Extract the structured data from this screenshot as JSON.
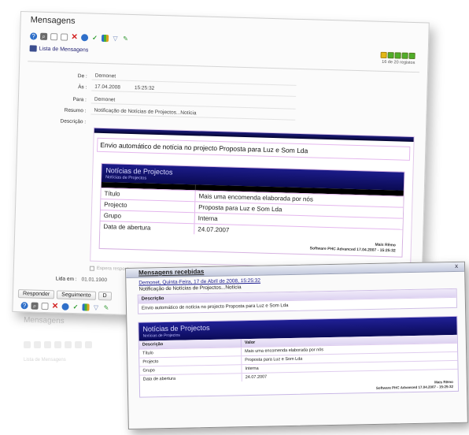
{
  "main_window": {
    "title": "Mensagens",
    "title_right": "",
    "list_link": "Lista de Mensagens",
    "record_count": "16 de 20 registos",
    "fields": [
      {
        "label": "De :",
        "value": "Demonet"
      },
      {
        "label": "Às :",
        "value": "17.04.2008          15:25:32"
      },
      {
        "label": "Para :",
        "value": "Demonet"
      },
      {
        "label": "Resumo :",
        "value": "Notificação de Notícias de Projectos...Notícia"
      },
      {
        "label": "Descrição :",
        "value": ""
      }
    ],
    "description_text": "Envio automático de notícia no projecto Proposta para Luz e Som Lda",
    "card": {
      "title": "Notícias de Projectos",
      "subtitle": "Notícias de Projectos",
      "rows": [
        {
          "key": "Título",
          "value": "Mais uma encomenda elaborada por nós"
        },
        {
          "key": "Projecto",
          "value": "Proposta para Luz e Som Lda"
        },
        {
          "key": "Grupo",
          "value": "Interna"
        },
        {
          "key": "Data de abertura",
          "value": "24.07.2007"
        }
      ],
      "signature_name": "Mais Rêmo",
      "signature_line": "Software PHC Advanced 17.04.2007 - 15:25:32"
    },
    "wait_reply_label": "Espera resposta",
    "lida_label": "Lida em :",
    "lida_value": "01.01.1900",
    "buttons": [
      "Responder",
      "Seguimento",
      "D"
    ]
  },
  "reflection": {
    "title": "Mensagens",
    "link": "Lista de Mensagens"
  },
  "popup": {
    "title": "Mensagens recebidas",
    "close": "x",
    "from_line": "Demonet, Quinta-Feira, 17 de Abril de 2008, 15:25:32",
    "subject": "Notificação de Notícias de Projectos...Notícia",
    "desc_header": "Descrição",
    "desc_text": "Envio automático de notícia no projecto Proposta para Luz e Som Lda",
    "card": {
      "title": "Notícias de Projectos",
      "subtitle": "Notícias de Projectos",
      "col_desc": "Descrição",
      "col_val": "Valor",
      "rows": [
        {
          "key": "Título",
          "value": "Mais uma encomenda elaborada por nós"
        },
        {
          "key": "Projecto",
          "value": "Proposta para Luz e Som Lda"
        },
        {
          "key": "Grupo",
          "value": "Interna"
        },
        {
          "key": "Data de abertura",
          "value": "24.07.2007"
        }
      ],
      "signature_name": "Mais Rêmo",
      "signature_line": "Software PHC Advanced 17.04.2007 - 15:25:32"
    }
  },
  "icons": {
    "toolbar": [
      "help-icon",
      "search-icon",
      "new-icon",
      "copy-icon",
      "delete-icon",
      "refresh-icon",
      "check-icon",
      "chart-icon",
      "filter-icon",
      "edit-icon"
    ],
    "nav_colors": [
      "#e3b716",
      "#4fae29",
      "#4fae29",
      "#4fae29",
      "#4fae29"
    ],
    "toolbar_colors": [
      "#2e6fc9",
      "#6b6b6b",
      "#9a9a9a",
      "#9a9a9a",
      "#d22020",
      "#2e6fc9",
      "#2a9a2a",
      "#2e6fc9",
      "#7a8fbf",
      "#3b9c3b"
    ]
  }
}
